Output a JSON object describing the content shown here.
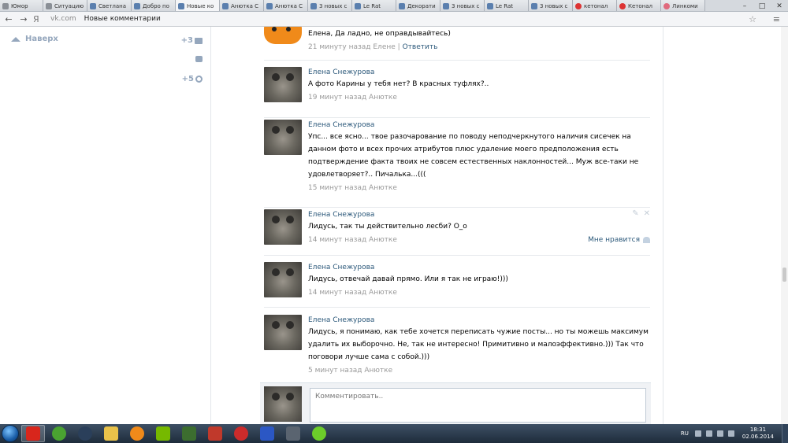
{
  "browser": {
    "tabs": [
      {
        "label": "Юмор",
        "fav": "gray"
      },
      {
        "label": "Ситуацию",
        "fav": "gray"
      },
      {
        "label": "Светлана",
        "fav": "vk"
      },
      {
        "label": "Добро по",
        "fav": "vk"
      },
      {
        "label": "Новые ко",
        "fav": "vk",
        "active": true
      },
      {
        "label": "Анютка С",
        "fav": "vk"
      },
      {
        "label": "Анютка С",
        "fav": "vk"
      },
      {
        "label": "3 новых с",
        "fav": "vk"
      },
      {
        "label": "Le Rat",
        "fav": "vk"
      },
      {
        "label": "Декорати",
        "fav": "vk"
      },
      {
        "label": "3 новых с",
        "fav": "vk"
      },
      {
        "label": "Le Rat",
        "fav": "vk"
      },
      {
        "label": "3 новых с",
        "fav": "vk"
      },
      {
        "label": "кетонал",
        "fav": "red"
      },
      {
        "label": "Кетонал",
        "fav": "red"
      },
      {
        "label": "Линкоми",
        "fav": "pink"
      }
    ],
    "nav_back_icon": "arrow-left-icon",
    "nav_forward_icon": "arrow-right-icon",
    "yandex_button": "Я",
    "url": "vk.com",
    "page_title": "Новые комментарии"
  },
  "sidebar": {
    "to_top": "Наверх",
    "stat_likes": "+3",
    "stat_settings": "+5"
  },
  "comments": [
    {
      "author": "",
      "text": "Елена, Да ладно, не оправдывайтесь)",
      "time": "21 минуту назад Елене",
      "reply": "Ответить",
      "avatar": "fox-avatar"
    },
    {
      "author": "Елена Снежурова",
      "text": "А фото Карины у тебя нет? В красных туфлях?..",
      "time": "19 минут назад Анютке"
    },
    {
      "author": "Елена Снежурова",
      "text": "Упс... все ясно... твое разочарование по поводу неподчеркнутого наличия сисечек на данном фото и всех прочих атрибутов плюс удаление моего предположения есть подтверждение факта твоих не совсем естественных наклонностей... Муж все-таки не удовлетворяет?.. Пичалька...(((",
      "time": "15 минут назад Анютке"
    },
    {
      "author": "Елена Снежурова",
      "text": "Лидусь, так ты действительно лесби? О_о",
      "time": "14 минут назад Анютке",
      "like": "Мне нравится"
    },
    {
      "author": "Елена Снежурова",
      "text": "Лидусь, отвечай давай прямо. Или я так не играю!)))",
      "time": "14 минут назад Анютке"
    },
    {
      "author": "Елена Снежурова",
      "text": "Лидусь, я понимаю, как тебе хочется переписать чужие посты... но ты можешь максимум удалить их выборочно. Не, так не интересно! Примитивно и малоэффективно.))) Так что поговори лучше сама с собой.)))",
      "time": "5 минут назад Анютке"
    }
  ],
  "composer": {
    "placeholder": "Комментировать.."
  },
  "taskbar": {
    "lang": "RU",
    "time": "18:31",
    "date": "02.06.2014"
  },
  "colors": {
    "link": "#2b587a",
    "meta": "#999999",
    "sidebar": "#95a7bd"
  }
}
